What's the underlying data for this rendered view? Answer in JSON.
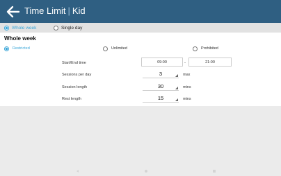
{
  "header": {
    "title": "Time Limit",
    "separator": "|",
    "profile": "Kid",
    "background": "#2f5f82"
  },
  "tabs": [
    {
      "label": "Whole week",
      "selected": true
    },
    {
      "label": "Single day",
      "selected": false
    }
  ],
  "section": {
    "title": "Whole week",
    "options": [
      {
        "label": "Restricted",
        "selected": true
      },
      {
        "label": "Unlimited",
        "selected": false
      },
      {
        "label": "Prohibited",
        "selected": false
      }
    ]
  },
  "settings": {
    "start_end_label": "Start/End time",
    "start_time": "09:00",
    "end_time": "21:00",
    "time_separator": "-",
    "sessions_label": "Sessions per day",
    "sessions_value": "3",
    "sessions_unit": "max",
    "session_length_label": "Session length",
    "session_length_value": "30",
    "session_length_unit": "mins",
    "rest_length_label": "Rest length",
    "rest_length_value": "15",
    "rest_length_unit": "mins"
  },
  "colors": {
    "accent": "#3aa6d8",
    "appbar": "#2f5f82"
  },
  "icons": {
    "back": "arrow-left-icon"
  }
}
